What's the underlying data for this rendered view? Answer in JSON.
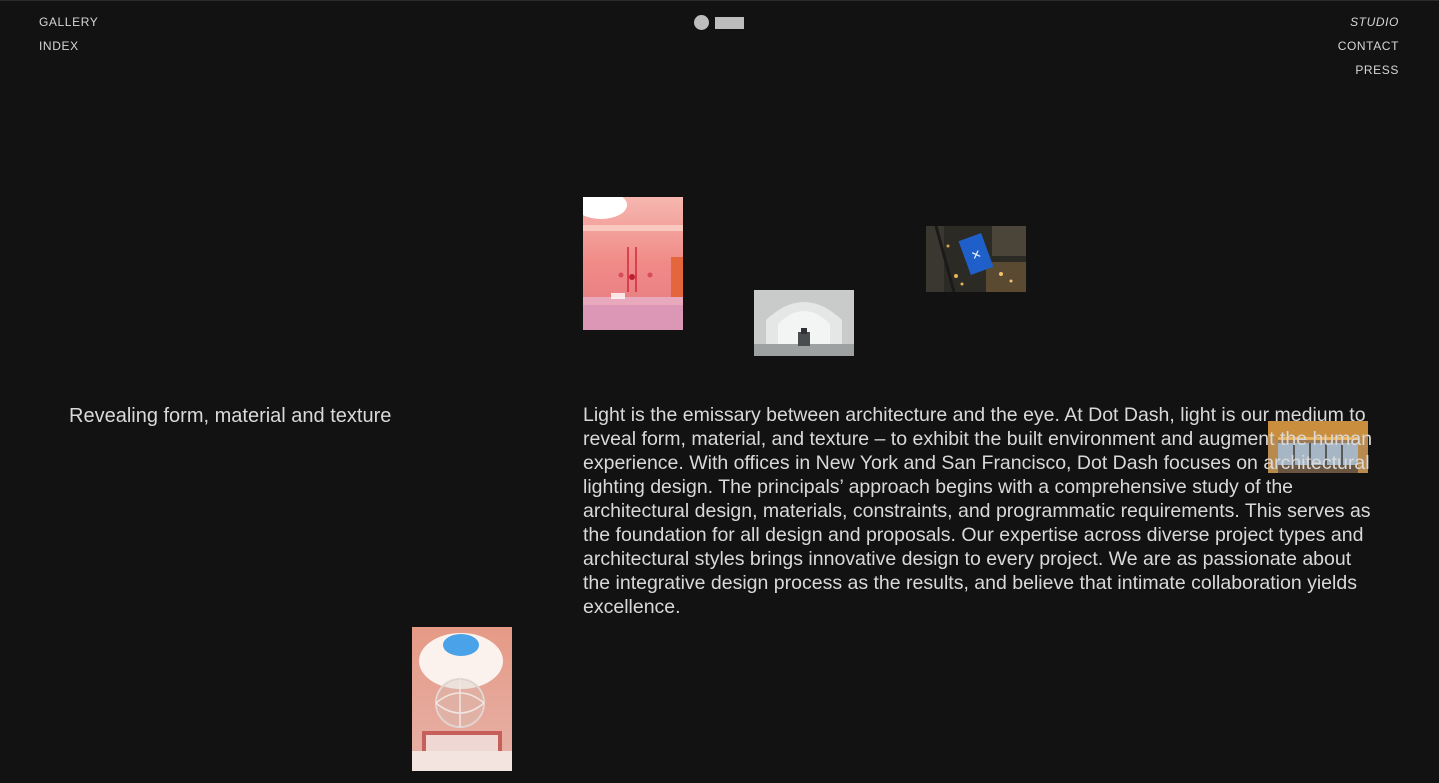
{
  "nav": {
    "left": [
      {
        "label": "GALLERY"
      },
      {
        "label": "INDEX"
      }
    ],
    "right": [
      {
        "label": "STUDIO"
      },
      {
        "label": "CONTACT"
      },
      {
        "label": "PRESS"
      }
    ]
  },
  "logo": {
    "icon": "dot-dash-logo",
    "color": "#bdbdbd"
  },
  "main": {
    "subheading": "Revealing form, material and texture",
    "body": "Light is the emissary between architecture and the eye. At Dot Dash, light is our medium to reveal form, material, and texture – to exhibit the built environment and augment the human experience. With offices in New York and San Francisco, Dot Dash focuses on architectural lighting design. The principals’ approach begins with a comprehensive study of the architectural design, materials, constraints, and programmatic requirements. This serves as the foundation for all design and proposals. Our expertise across diverse project types and architectural styles brings innovative design to every project. We are as passionate about the integrative design process as the results, and believe that intimate collaboration yields excellence."
  },
  "colors": {
    "background": "#121212",
    "text": "#d9d9d9",
    "nav_text": "#d6d6d6"
  },
  "gallery": [
    {
      "icon": "pink-interior-photo"
    },
    {
      "icon": "white-arch-photo"
    },
    {
      "icon": "aerial-city-night-photo"
    },
    {
      "icon": "wood-ceiling-interior-photo"
    },
    {
      "icon": "skylight-sculpture-photo"
    }
  ]
}
